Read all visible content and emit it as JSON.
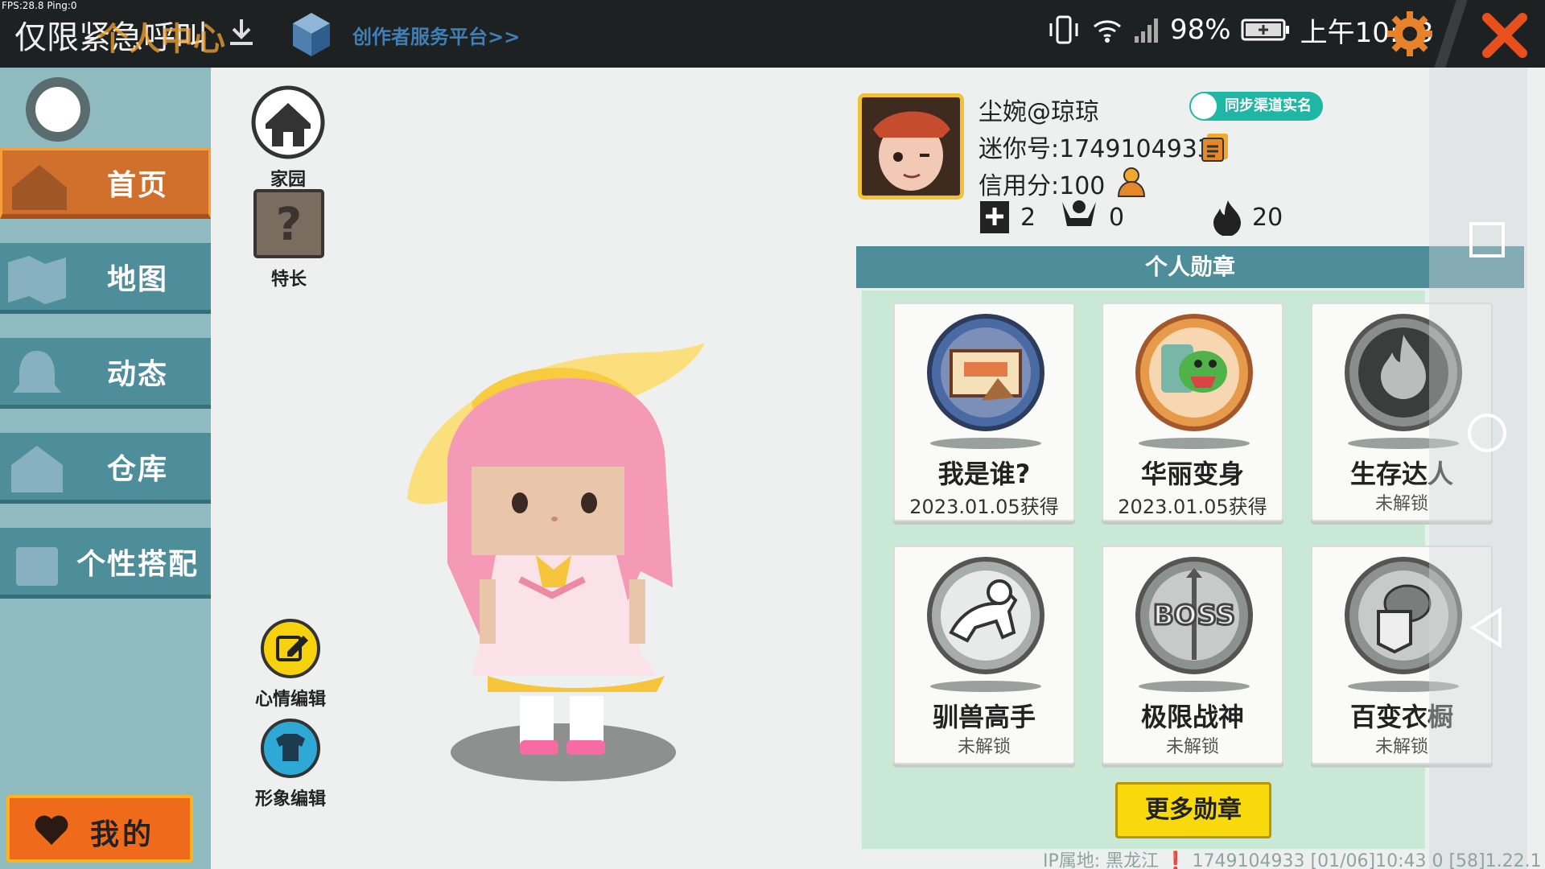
{
  "fps": "FPS:28.8  Ping:0",
  "emergency_text": "仅限紧急呼叫",
  "ghost_title": "个人中心",
  "creator_link": "创作者服务平台>>",
  "status": {
    "battery": "98%",
    "time": "上午10:43"
  },
  "nav": [
    {
      "label": "首页",
      "active": true
    },
    {
      "label": "地图",
      "active": false
    },
    {
      "label": "动态",
      "active": false
    },
    {
      "label": "仓库",
      "active": false
    },
    {
      "label": "个性搭配",
      "active": false
    }
  ],
  "mine_label": "我的",
  "tools": {
    "home": "家园",
    "talent": "特长",
    "mood_edit": "心情编辑",
    "avatar_edit": "形象编辑"
  },
  "profile": {
    "name": "尘婉@琼琼",
    "sync_label": "同步渠道实名",
    "mini_id": "迷你号:1749104933",
    "credit": "信用分:100",
    "stats": {
      "friends": "2",
      "likes": "0",
      "hot": "20"
    }
  },
  "medals": {
    "header": "个人勋章",
    "items": [
      {
        "name": "我是谁?",
        "date": "2023.01.05获得",
        "status": "",
        "icon": "mail-medal-icon"
      },
      {
        "name": "华丽变身",
        "date": "2023.01.05获得",
        "status": "",
        "icon": "dino-medal-icon"
      },
      {
        "name": "生存达人",
        "date": "",
        "status": "未解锁",
        "icon": "fire-medal-icon"
      },
      {
        "name": "驯兽高手",
        "date": "",
        "status": "未解锁",
        "icon": "horse-medal-icon"
      },
      {
        "name": "极限战神",
        "date": "",
        "status": "未解锁",
        "icon": "boss-medal-icon"
      },
      {
        "name": "百变衣橱",
        "date": "",
        "status": "未解锁",
        "icon": "wardrobe-medal-icon"
      }
    ],
    "more_label": "更多勋章"
  },
  "footer": "IP属地: 黑龙江 ❗   1749104933   [01/06]10:43 0  [58]1.22.1",
  "colors": {
    "nav": "#4e8e9b",
    "active": "#d0702c",
    "panel": "#c9e8d6",
    "accent": "#f7d90c"
  }
}
